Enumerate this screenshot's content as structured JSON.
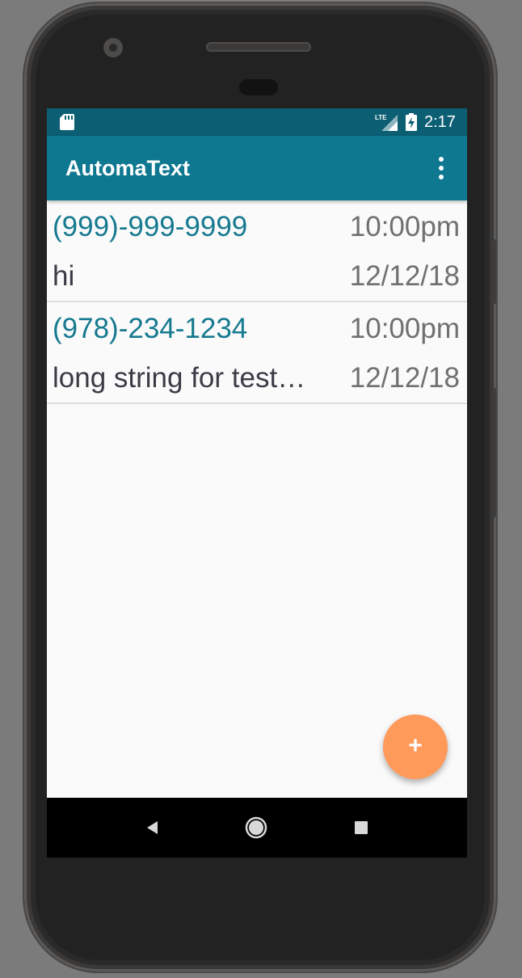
{
  "status_bar": {
    "time": "2:17",
    "network_label": "LTE",
    "icons": [
      "sd-card-icon",
      "lte-signal-icon",
      "battery-charging-icon"
    ]
  },
  "app_bar": {
    "title": "AutomaText",
    "menu_icon": "more-vert-icon"
  },
  "messages": [
    {
      "phone": "(999)-999-9999",
      "time": "10:00pm",
      "text": "hi",
      "date": "12/12/18"
    },
    {
      "phone": "(978)-234-1234",
      "time": "10:00pm",
      "text": "long string for test…",
      "date": "12/12/18"
    }
  ],
  "fab": {
    "label": "+",
    "icon": "add-icon"
  },
  "nav_bar": {
    "icons": [
      "back-icon",
      "home-icon",
      "recents-icon"
    ]
  },
  "colors": {
    "status_bar": "#0c5e73",
    "app_bar": "#0e7890",
    "accent_text": "#167a90",
    "fab": "#ff9a5b"
  }
}
